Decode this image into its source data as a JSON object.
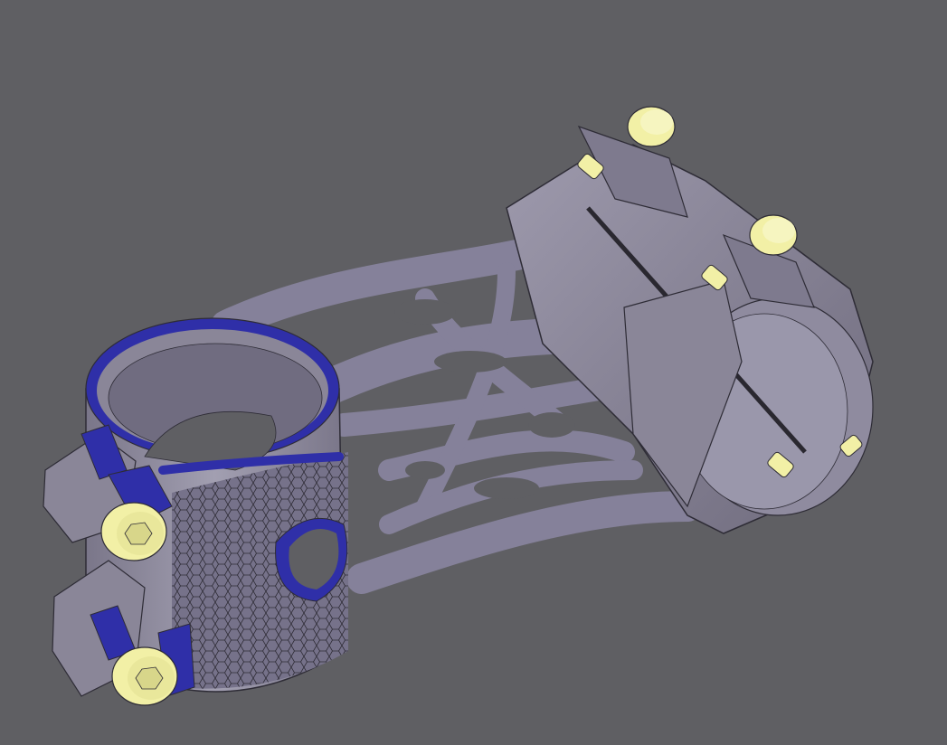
{
  "viewport": {
    "background": "#5f5f63",
    "model_icon": "bicycle-stem-3d-model-icon"
  },
  "colors": {
    "body": "#8a8698",
    "body_dark": "#6c6879",
    "body_light": "#aaa6b8",
    "edge": "#2e2c36",
    "accent": "#2f2fa8",
    "bolt": "#f2f0a6",
    "bolt_shadow": "#c9c782"
  }
}
